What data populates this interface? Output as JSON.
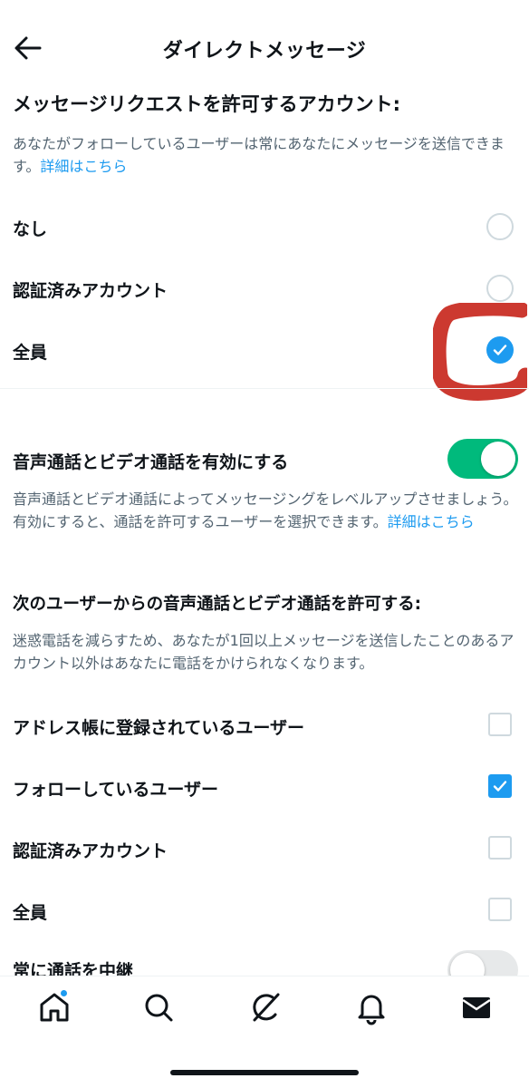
{
  "header": {
    "title": "ダイレクトメッセージ",
    "back_icon": "arrow-left-icon"
  },
  "message_requests": {
    "title": "メッセージリクエストを許可するアカウント:",
    "description": "あなたがフォローしているユーザーは常にあなたにメッセージを送信できます。",
    "link": "詳細はこちら",
    "options": [
      {
        "label": "なし",
        "selected": false
      },
      {
        "label": "認証済みアカウント",
        "selected": false
      },
      {
        "label": "全員",
        "selected": true
      }
    ]
  },
  "calls": {
    "toggle_label": "音声通話とビデオ通話を有効にする",
    "toggle_on": true,
    "toggle_color": "#00ba7c",
    "description": "音声通話とビデオ通話によってメッセージングをレベルアップさせましょう。有効にすると、通話を許可するユーザーを選択できます。",
    "link": "詳細はこちら"
  },
  "call_permissions": {
    "title": "次のユーザーからの音声通話とビデオ通話を許可する:",
    "description": "迷惑電話を減らすため、あなたが1回以上メッセージを送信したことのあるアカウント以外はあなたに電話をかけられなくなります。",
    "options": [
      {
        "label": "アドレス帳に登録されているユーザー",
        "checked": false
      },
      {
        "label": "フォローしているユーザー",
        "checked": true
      },
      {
        "label": "認証済みアカウント",
        "checked": false
      },
      {
        "label": "全員",
        "checked": false
      }
    ]
  },
  "relay": {
    "label": "常に通話を中継",
    "toggle_on": false
  },
  "tabbar": {
    "tabs": [
      "home-icon",
      "search-icon",
      "grok-icon",
      "bell-icon",
      "mail-icon"
    ],
    "active": "mail-icon"
  },
  "colors": {
    "accent": "#1d9bf0",
    "annotation": "#c8281e"
  }
}
